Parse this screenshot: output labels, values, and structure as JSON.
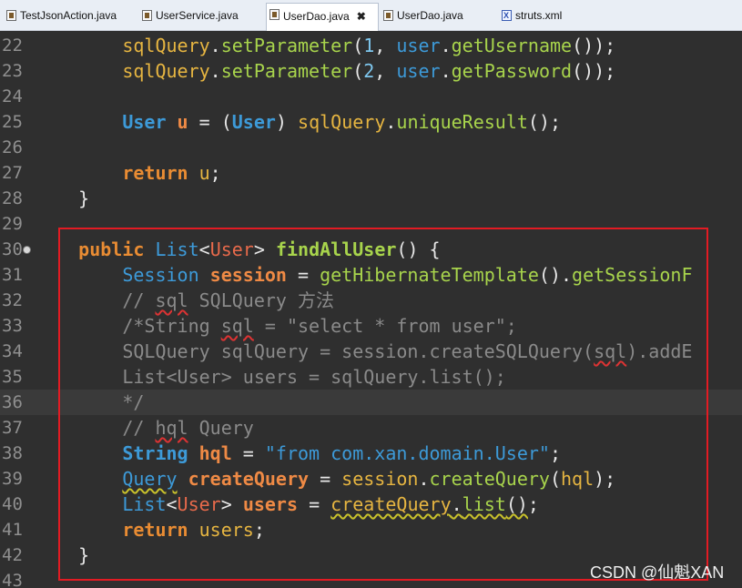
{
  "tabs": [
    {
      "label": "TestJsonAction.java",
      "icon": "java-file-icon",
      "active": false
    },
    {
      "label": "UserService.java",
      "icon": "java-file-icon",
      "active": false
    },
    {
      "label": "UserDao.java",
      "icon": "java-file-icon",
      "active": true,
      "close": "✖"
    },
    {
      "label": "UserDao.java",
      "icon": "java-file-icon",
      "active": false
    },
    {
      "label": "struts.xml",
      "icon": "xml-file-icon",
      "active": false
    }
  ],
  "lines": [
    {
      "num": "22",
      "tokens": [
        {
          "t": "        ",
          "c": "pl"
        },
        {
          "t": "sqlQuery",
          "c": "var"
        },
        {
          "t": ".",
          "c": "pl"
        },
        {
          "t": "setParameter",
          "c": "fn"
        },
        {
          "t": "(",
          "c": "pl"
        },
        {
          "t": "1",
          "c": "lit"
        },
        {
          "t": ", ",
          "c": "pl"
        },
        {
          "t": "user",
          "c": "type"
        },
        {
          "t": ".",
          "c": "pl"
        },
        {
          "t": "getUsername",
          "c": "fn"
        },
        {
          "t": "());",
          "c": "pl"
        }
      ]
    },
    {
      "num": "23",
      "tokens": [
        {
          "t": "        ",
          "c": "pl"
        },
        {
          "t": "sqlQuery",
          "c": "var"
        },
        {
          "t": ".",
          "c": "pl"
        },
        {
          "t": "setParameter",
          "c": "fn"
        },
        {
          "t": "(",
          "c": "pl"
        },
        {
          "t": "2",
          "c": "lit"
        },
        {
          "t": ", ",
          "c": "pl"
        },
        {
          "t": "user",
          "c": "type"
        },
        {
          "t": ".",
          "c": "pl"
        },
        {
          "t": "getPassword",
          "c": "fn"
        },
        {
          "t": "());",
          "c": "pl"
        }
      ]
    },
    {
      "num": "24",
      "tokens": []
    },
    {
      "num": "25",
      "tokens": [
        {
          "t": "        ",
          "c": "pl"
        },
        {
          "t": "User",
          "c": "typeb"
        },
        {
          "t": " ",
          "c": "pl"
        },
        {
          "t": "u",
          "c": "varb"
        },
        {
          "t": " = (",
          "c": "pl"
        },
        {
          "t": "User",
          "c": "typeb"
        },
        {
          "t": ") ",
          "c": "pl"
        },
        {
          "t": "sqlQuery",
          "c": "var"
        },
        {
          "t": ".",
          "c": "pl"
        },
        {
          "t": "uniqueResult",
          "c": "fn"
        },
        {
          "t": "();",
          "c": "pl"
        }
      ]
    },
    {
      "num": "26",
      "tokens": []
    },
    {
      "num": "27",
      "tokens": [
        {
          "t": "        ",
          "c": "pl"
        },
        {
          "t": "return",
          "c": "kw"
        },
        {
          "t": " ",
          "c": "pl"
        },
        {
          "t": "u",
          "c": "var"
        },
        {
          "t": ";",
          "c": "pl"
        }
      ]
    },
    {
      "num": "28",
      "tokens": [
        {
          "t": "    }",
          "c": "pl"
        }
      ]
    },
    {
      "num": "29",
      "tokens": []
    },
    {
      "num": "30",
      "marker": true,
      "tokens": [
        {
          "t": "    ",
          "c": "pl"
        },
        {
          "t": "public",
          "c": "kw"
        },
        {
          "t": " ",
          "c": "pl"
        },
        {
          "t": "List",
          "c": "type"
        },
        {
          "t": "<",
          "c": "pl"
        },
        {
          "t": "User",
          "c": "gen"
        },
        {
          "t": "> ",
          "c": "pl"
        },
        {
          "t": "findAllUser",
          "c": "fnb"
        },
        {
          "t": "() {",
          "c": "pl"
        }
      ]
    },
    {
      "num": "31",
      "tokens": [
        {
          "t": "        ",
          "c": "pl"
        },
        {
          "t": "Session",
          "c": "type"
        },
        {
          "t": " ",
          "c": "pl"
        },
        {
          "t": "session",
          "c": "varb"
        },
        {
          "t": " = ",
          "c": "pl"
        },
        {
          "t": "getHibernateTemplate",
          "c": "fn"
        },
        {
          "t": "().",
          "c": "pl"
        },
        {
          "t": "getSessionF",
          "c": "fn"
        }
      ]
    },
    {
      "num": "32",
      "tokens": [
        {
          "t": "        // ",
          "c": "cmt"
        },
        {
          "t": "sql",
          "c": "cmt wavyr"
        },
        {
          "t": " SQLQuery 方法",
          "c": "cmt"
        }
      ]
    },
    {
      "num": "33",
      "tokens": [
        {
          "t": "        /*String ",
          "c": "cmt"
        },
        {
          "t": "sql",
          "c": "cmt wavyr"
        },
        {
          "t": " = \"select * from user\";",
          "c": "cmt"
        }
      ]
    },
    {
      "num": "34",
      "tokens": [
        {
          "t": "        SQLQuery sqlQuery = session.createSQLQuery(",
          "c": "cmt"
        },
        {
          "t": "sql",
          "c": "cmt wavyr"
        },
        {
          "t": ").addE",
          "c": "cmt"
        }
      ]
    },
    {
      "num": "35",
      "tokens": [
        {
          "t": "        List<User> users = sqlQuery.list();",
          "c": "cmt"
        }
      ]
    },
    {
      "num": "36",
      "current": true,
      "tokens": [
        {
          "t": "        */",
          "c": "cmt"
        }
      ]
    },
    {
      "num": "37",
      "tokens": [
        {
          "t": "        // ",
          "c": "cmt"
        },
        {
          "t": "hql",
          "c": "cmt wavyr"
        },
        {
          "t": " Query",
          "c": "cmt"
        }
      ]
    },
    {
      "num": "38",
      "tokens": [
        {
          "t": "        ",
          "c": "pl"
        },
        {
          "t": "String",
          "c": "typeb"
        },
        {
          "t": " ",
          "c": "pl"
        },
        {
          "t": "hql",
          "c": "varb"
        },
        {
          "t": " = ",
          "c": "pl"
        },
        {
          "t": "\"from com.xan.domain.User\"",
          "c": "str"
        },
        {
          "t": ";",
          "c": "pl"
        }
      ]
    },
    {
      "num": "39",
      "tokens": [
        {
          "t": "        ",
          "c": "pl"
        },
        {
          "t": "Query",
          "c": "type wavy"
        },
        {
          "t": " ",
          "c": "pl"
        },
        {
          "t": "createQuery",
          "c": "varb"
        },
        {
          "t": " = ",
          "c": "pl"
        },
        {
          "t": "session",
          "c": "var"
        },
        {
          "t": ".",
          "c": "pl"
        },
        {
          "t": "createQuery",
          "c": "fn"
        },
        {
          "t": "(",
          "c": "pl"
        },
        {
          "t": "hql",
          "c": "var"
        },
        {
          "t": ");",
          "c": "pl"
        }
      ]
    },
    {
      "num": "40",
      "tokens": [
        {
          "t": "        ",
          "c": "pl"
        },
        {
          "t": "List",
          "c": "type"
        },
        {
          "t": "<",
          "c": "pl"
        },
        {
          "t": "User",
          "c": "gen"
        },
        {
          "t": "> ",
          "c": "pl"
        },
        {
          "t": "users",
          "c": "varb"
        },
        {
          "t": " = ",
          "c": "pl"
        },
        {
          "t": "createQuery",
          "c": "var wavy"
        },
        {
          "t": ".",
          "c": "pl wavy"
        },
        {
          "t": "list",
          "c": "fn wavy"
        },
        {
          "t": "()",
          "c": "pl wavy"
        },
        {
          "t": ";",
          "c": "pl"
        }
      ]
    },
    {
      "num": "41",
      "tokens": [
        {
          "t": "        ",
          "c": "pl"
        },
        {
          "t": "return",
          "c": "kw"
        },
        {
          "t": " ",
          "c": "pl"
        },
        {
          "t": "users",
          "c": "var"
        },
        {
          "t": ";",
          "c": "pl"
        }
      ]
    },
    {
      "num": "42",
      "tokens": [
        {
          "t": "    }",
          "c": "pl"
        }
      ]
    },
    {
      "num": "43",
      "tokens": []
    }
  ],
  "watermark": "CSDN @仙魁XAN"
}
